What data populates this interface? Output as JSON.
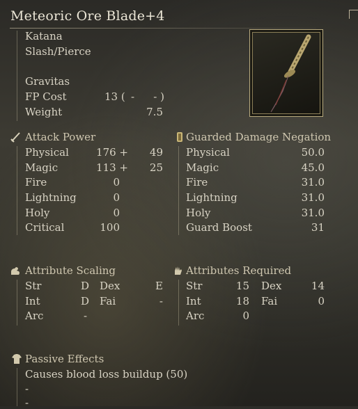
{
  "weapon": {
    "name": "Meteoric Ore Blade+4",
    "type": "Katana",
    "damage_type": "Slash/Pierce",
    "skill": "Gravitas",
    "fp_cost_label": "FP Cost",
    "fp_cost_value": "13 (",
    "fp_cost_dash1": "-",
    "fp_cost_dash2": "- )",
    "weight_label": "Weight",
    "weight_value": "7.5"
  },
  "attack_power": {
    "heading": "Attack Power",
    "rows": [
      {
        "label": "Physical",
        "base": "176 +",
        "bonus": "49"
      },
      {
        "label": "Magic",
        "base": "113 +",
        "bonus": "25"
      },
      {
        "label": "Fire",
        "base": "0",
        "bonus": ""
      },
      {
        "label": "Lightning",
        "base": "0",
        "bonus": ""
      },
      {
        "label": "Holy",
        "base": "0",
        "bonus": ""
      },
      {
        "label": "Critical",
        "base": "100",
        "bonus": ""
      }
    ]
  },
  "guard": {
    "heading": "Guarded Damage Negation",
    "rows": [
      {
        "label": "Physical",
        "value": "50.0"
      },
      {
        "label": "Magic",
        "value": "45.0"
      },
      {
        "label": "Fire",
        "value": "31.0"
      },
      {
        "label": "Lightning",
        "value": "31.0"
      },
      {
        "label": "Holy",
        "value": "31.0"
      },
      {
        "label": "Guard Boost",
        "value": "31"
      }
    ]
  },
  "scaling": {
    "heading": "Attribute Scaling",
    "str_label": "Str",
    "str_value": "D",
    "dex_label": "Dex",
    "dex_value": "E",
    "int_label": "Int",
    "int_value": "D",
    "fai_label": "Fai",
    "fai_value": "-",
    "arc_label": "Arc",
    "arc_value": "-"
  },
  "required": {
    "heading": "Attributes Required",
    "str_label": "Str",
    "str_value": "15",
    "dex_label": "Dex",
    "dex_value": "14",
    "int_label": "Int",
    "int_value": "18",
    "fai_label": "Fai",
    "fai_value": "0",
    "arc_label": "Arc",
    "arc_value": "0"
  },
  "passive": {
    "heading": "Passive Effects",
    "effects": [
      "Causes blood loss buildup (50)",
      "-",
      "-"
    ]
  },
  "icons": {
    "attack": "sword-icon",
    "guard": "shield-icon",
    "scaling": "arm-icon",
    "required": "hand-icon",
    "passive": "tunic-icon",
    "item": "katana-icon"
  },
  "colors": {
    "text": "#d8d3c4",
    "heading": "#cfc7b0",
    "frame": "#b9ab7e"
  }
}
